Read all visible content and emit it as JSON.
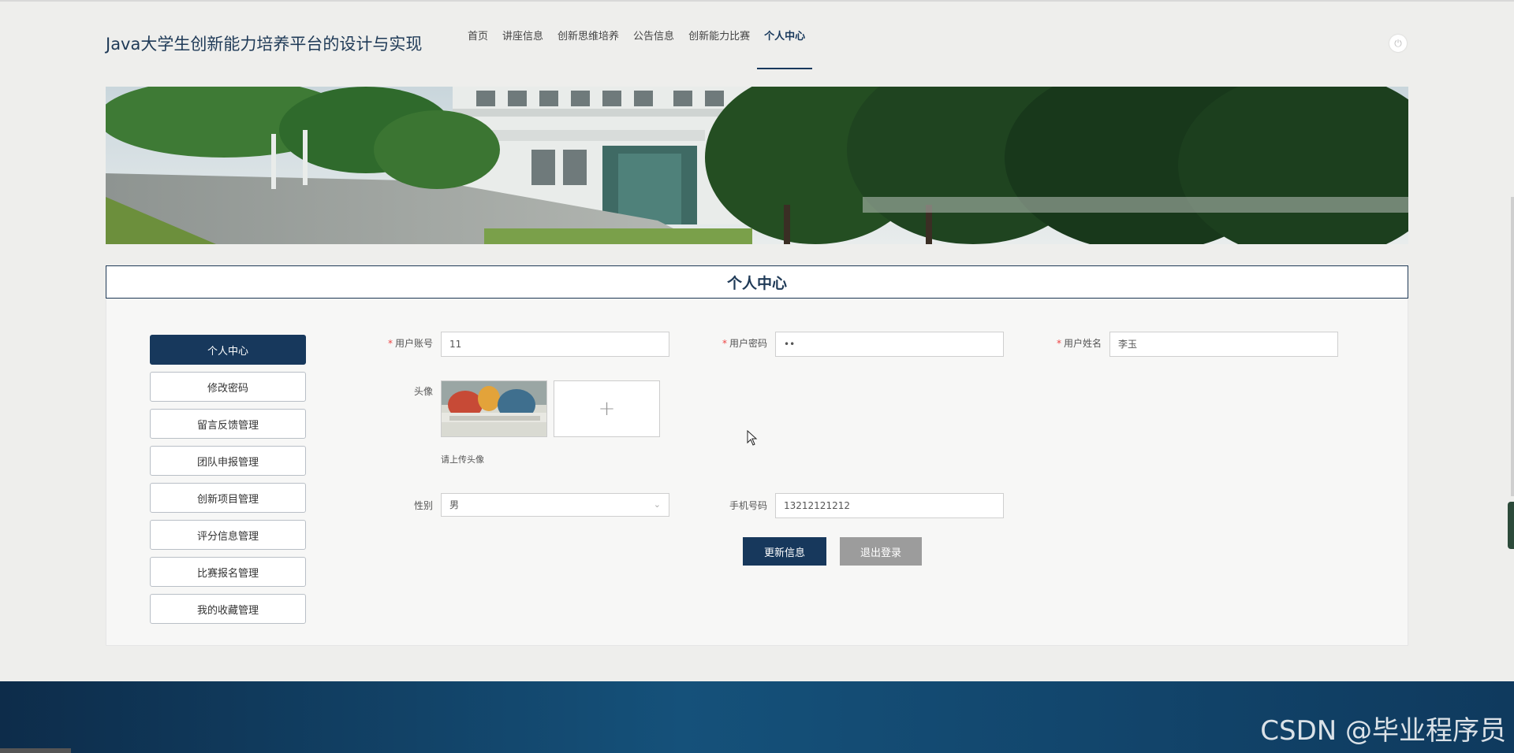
{
  "site": {
    "title": "Java大学生创新能力培养平台的设计与实现"
  },
  "nav": {
    "items": [
      "首页",
      "讲座信息",
      "创新思维培养",
      "公告信息",
      "创新能力比赛",
      "个人中心"
    ],
    "active": "个人中心"
  },
  "header": {
    "power_icon": "power-icon"
  },
  "section": {
    "title": "个人中心"
  },
  "side_menu": {
    "items": [
      "个人中心",
      "修改密码",
      "留言反馈管理",
      "团队申报管理",
      "创新项目管理",
      "评分信息管理",
      "比赛报名管理",
      "我的收藏管理"
    ],
    "active": "个人中心"
  },
  "form": {
    "account": {
      "label": "用户账号",
      "value": "11"
    },
    "password": {
      "label": "用户密码",
      "value": "••"
    },
    "name": {
      "label": "用户姓名",
      "value": "李玉"
    },
    "avatar": {
      "label": "头像",
      "hint": "请上传头像",
      "upload_symbol": "+"
    },
    "gender": {
      "label": "性别",
      "value": "男"
    },
    "phone": {
      "label": "手机号码",
      "value": "13212121212"
    },
    "required_mark": "*"
  },
  "buttons": {
    "update": "更新信息",
    "logout": "退出登录"
  },
  "watermark": "CSDN @毕业程序员",
  "colors": {
    "primary": "#17385c",
    "grey_button": "#9c9c9c",
    "footer": "#15517a"
  }
}
